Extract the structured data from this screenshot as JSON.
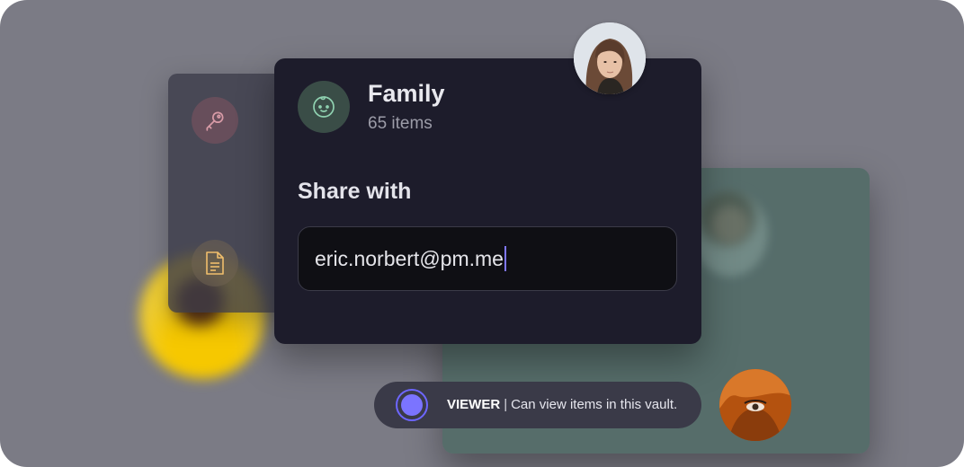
{
  "vault": {
    "name": "Family",
    "count": "65 items"
  },
  "share": {
    "title": "Share with",
    "email": "eric.norbert@pm.me"
  },
  "role": {
    "name": "VIEWER",
    "separator": "|",
    "description": "Can view items in this vault."
  },
  "side_items": [
    {
      "icon": "key-icon"
    },
    {
      "icon": "credit-card-icon"
    },
    {
      "icon": "note-icon"
    }
  ],
  "colors": {
    "background": "#7b7b85",
    "card": "#1d1c2b",
    "accent": "#7b74ff",
    "vault_icon_bg": "#3a4d47",
    "vault_icon": "#8fd1b0"
  }
}
